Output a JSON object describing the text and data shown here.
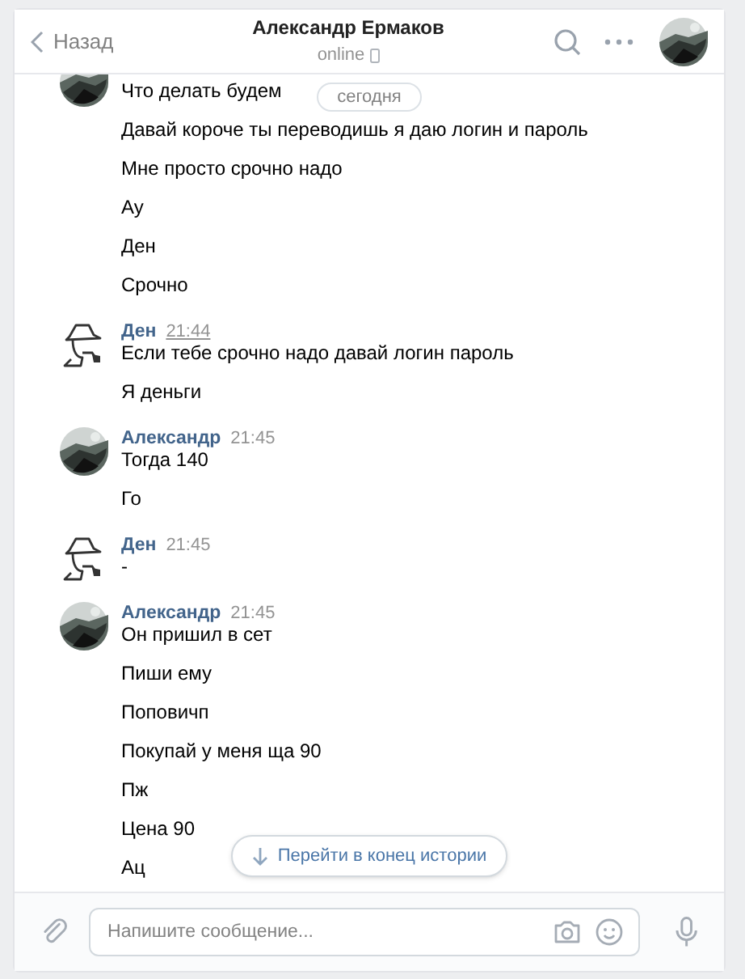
{
  "header": {
    "back": "Назад",
    "title": "Александр Ермаков",
    "status": "online"
  },
  "date_pill": "сегодня",
  "groups": [
    {
      "avatar": {
        "kind": "photo"
      },
      "lines": [
        "Что делать будем",
        "Давай короче ты переводишь я даю логин и пароль",
        "Мне просто срочно надо",
        "Ау",
        "Ден",
        "Срочно"
      ]
    },
    {
      "avatar": {
        "kind": "detective"
      },
      "author": "Ден",
      "time": "21:44",
      "time_hovered": true,
      "lines": [
        "Если тебе срочно надо давай логин пароль",
        "Я деньги"
      ]
    },
    {
      "avatar": {
        "kind": "photo"
      },
      "author": "Александр",
      "time": "21:45",
      "time_hovered": false,
      "lines": [
        "Тогда 140",
        "Го"
      ]
    },
    {
      "avatar": {
        "kind": "detective"
      },
      "author": "Ден",
      "time": "21:45",
      "time_hovered": false,
      "lines": [
        "-"
      ]
    },
    {
      "avatar": {
        "kind": "photo"
      },
      "author": "Александр",
      "time": "21:45",
      "time_hovered": false,
      "lines": [
        "Он пришил в сет",
        "Пиши ему",
        "Поповичп",
        "Покупай у меня ща 90",
        "Пж",
        "Цена 90",
        "Ац"
      ]
    }
  ],
  "jump_button": "Перейти в конец истории",
  "composer": {
    "placeholder": "Напишите сообщение..."
  }
}
